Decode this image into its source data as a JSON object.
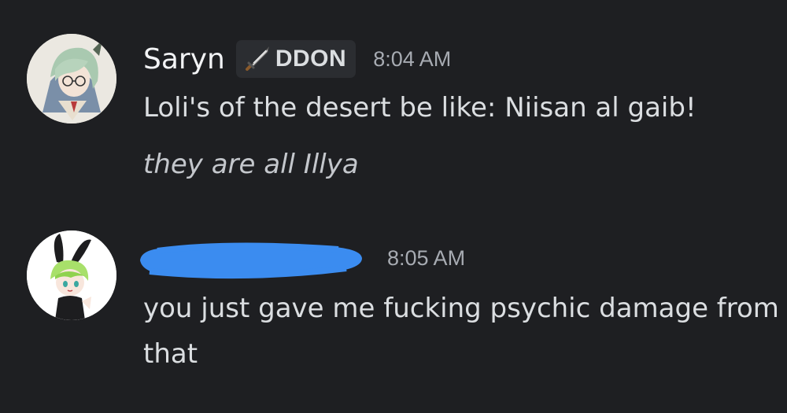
{
  "messages": [
    {
      "author": "Saryn",
      "role_tag": {
        "icon": "sword-icon",
        "label": "DDON"
      },
      "timestamp": "8:04 AM",
      "lines": [
        "Loli's of the desert be like: Niisan al gaib!",
        "they are all Illya"
      ],
      "avatar": "anime-character-avatar"
    },
    {
      "author": "",
      "author_redacted": true,
      "redaction_color": "#3b8cf0",
      "timestamp": "8:05 AM",
      "lines": [
        "you just gave me fucking psychic damage from that"
      ],
      "avatar": "bunny-ears-character-avatar"
    }
  ],
  "theme": {
    "background": "#1e1f22",
    "text": "#dbdee1",
    "muted": "#a7abb2"
  }
}
